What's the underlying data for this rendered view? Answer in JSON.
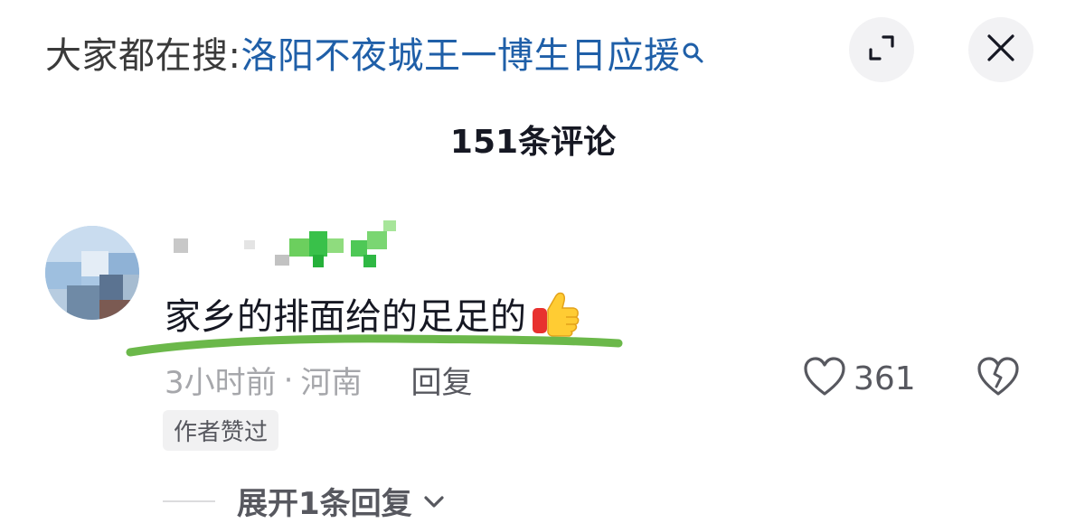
{
  "header": {
    "search_prefix": "大家都在搜:",
    "search_query": "洛阳不夜城王一博生日应援",
    "icons": {
      "search": "search-icon",
      "expand": "expand-icon",
      "close": "close-icon"
    }
  },
  "comments_panel": {
    "count_label": "151条评论"
  },
  "comment": {
    "text": "家乡的排面给的足足的",
    "emoji": "thumbs-up-emoji",
    "time": "3小时前",
    "separator": "·",
    "location": "河南",
    "reply_label": "回复",
    "like_count": "361",
    "author_liked_badge": "作者赞过",
    "expand_replies_label": "展开1条回复",
    "accent_colors": {
      "underline": "#6bb84a",
      "search_query": "#1f5fa8"
    }
  }
}
